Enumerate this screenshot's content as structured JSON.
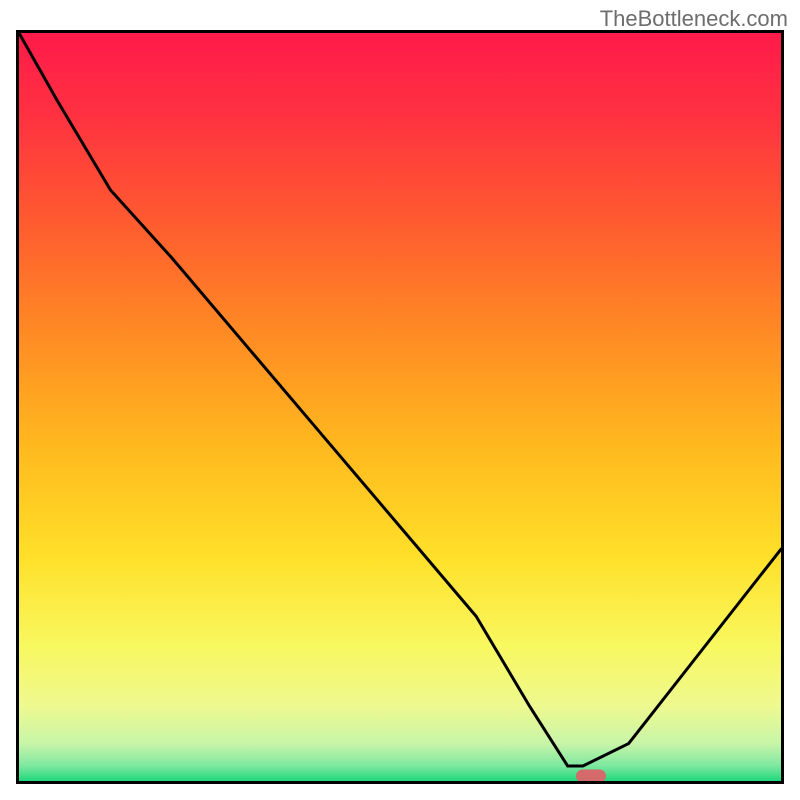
{
  "watermark": "TheBottleneck.com",
  "chart_data": {
    "type": "line",
    "x": [
      0.0,
      0.05,
      0.12,
      0.2,
      0.3,
      0.4,
      0.5,
      0.6,
      0.67,
      0.72,
      0.74,
      0.8,
      0.9,
      1.0
    ],
    "y": [
      1.0,
      0.91,
      0.79,
      0.7,
      0.58,
      0.46,
      0.34,
      0.22,
      0.1,
      0.02,
      0.02,
      0.05,
      0.18,
      0.31
    ],
    "title": "",
    "xlabel": "",
    "ylabel": "",
    "ylim": [
      0,
      1
    ],
    "xlim": [
      0,
      1
    ],
    "marker_x": 0.745,
    "marker_y": 0.015,
    "gradient_stops": [
      {
        "offset": 0.0,
        "color": "#ff1a4a"
      },
      {
        "offset": 0.1,
        "color": "#ff2f42"
      },
      {
        "offset": 0.25,
        "color": "#ff5a30"
      },
      {
        "offset": 0.4,
        "color": "#ff8a24"
      },
      {
        "offset": 0.55,
        "color": "#ffb81e"
      },
      {
        "offset": 0.7,
        "color": "#ffe029"
      },
      {
        "offset": 0.82,
        "color": "#f8f860"
      },
      {
        "offset": 0.9,
        "color": "#eef98f"
      },
      {
        "offset": 0.95,
        "color": "#c8f5a8"
      },
      {
        "offset": 0.98,
        "color": "#7de8a0"
      },
      {
        "offset": 1.0,
        "color": "#1fd87a"
      }
    ]
  }
}
